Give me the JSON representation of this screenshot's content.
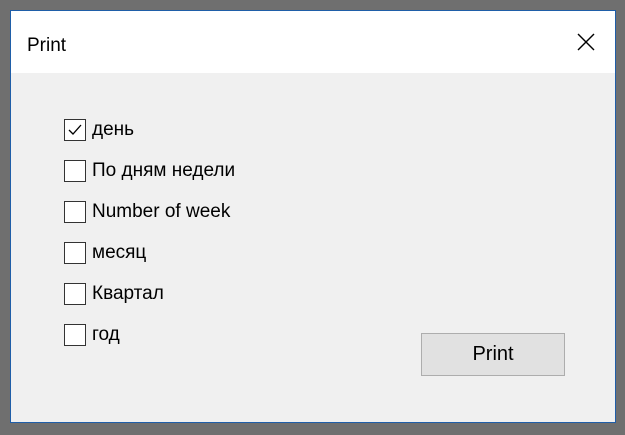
{
  "window": {
    "title": "Print",
    "close_icon": "close-icon"
  },
  "options": [
    {
      "label": "день",
      "checked": true
    },
    {
      "label": "По дням недели",
      "checked": false
    },
    {
      "label": "Number of week",
      "checked": false
    },
    {
      "label": "месяц",
      "checked": false
    },
    {
      "label": "Квартал",
      "checked": false
    },
    {
      "label": "год",
      "checked": false
    }
  ],
  "print_button": {
    "label": "Print"
  },
  "colors": {
    "window_border": "#1f5ea8",
    "body_bg": "#f0f0f0",
    "titlebar_bg": "#ffffff",
    "button_bg": "#e1e1e1"
  }
}
